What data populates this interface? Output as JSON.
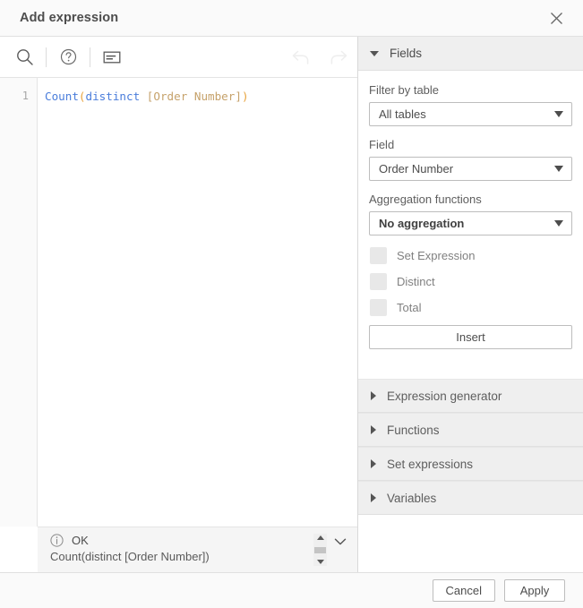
{
  "dialog": {
    "title": "Add expression",
    "close_icon": "close-icon"
  },
  "toolbar": {
    "search_icon": "search-icon",
    "help_icon": "help-circle-icon",
    "comment_icon": "comment-box-icon",
    "undo_icon": "undo-arrow-icon",
    "redo_icon": "redo-arrow-icon"
  },
  "editor": {
    "line_number": "1",
    "tokens": {
      "fn": "Count",
      "open_paren": "(",
      "keyword": "distinct",
      "space": " ",
      "field": "[Order Number]",
      "close_paren": ")"
    },
    "colors": {
      "function": "#4a7ddb",
      "punctuation": "#e8a33d",
      "keyword": "#4a7ddb",
      "field": "#c6a26b"
    }
  },
  "status": {
    "info_icon": "info-circle-icon",
    "label": "OK",
    "expression": "Count(distinct [Order Number])",
    "scroll_up_icon": "scroll-up-arrow-icon",
    "scroll_down_icon": "scroll-down-arrow-icon",
    "expand_icon": "chevron-down-icon"
  },
  "panel": {
    "fields": {
      "header": "Fields",
      "filter_by_table_label": "Filter by table",
      "filter_by_table_value": "All tables",
      "field_label": "Field",
      "field_value": "Order Number",
      "aggregation_label": "Aggregation functions",
      "aggregation_value": "No aggregation",
      "checkboxes": [
        {
          "label": "Set Expression",
          "checked": false
        },
        {
          "label": "Distinct",
          "checked": false
        },
        {
          "label": "Total",
          "checked": false
        }
      ],
      "insert_label": "Insert"
    },
    "sections": [
      {
        "label": "Expression generator",
        "expanded": false
      },
      {
        "label": "Functions",
        "expanded": false
      },
      {
        "label": "Set expressions",
        "expanded": false
      },
      {
        "label": "Variables",
        "expanded": false
      }
    ]
  },
  "footer": {
    "cancel_label": "Cancel",
    "apply_label": "Apply"
  }
}
